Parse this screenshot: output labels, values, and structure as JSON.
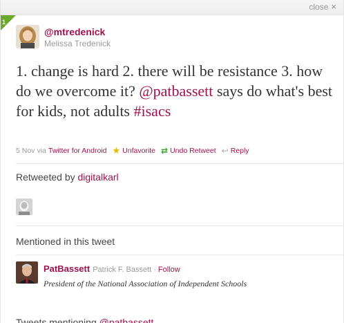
{
  "window": {
    "close_label": "close",
    "close_icon": "×"
  },
  "badge": {
    "count": "1",
    "color": "#6aa92a"
  },
  "tweet": {
    "handle": "@mtredenick",
    "full_name": "Melissa Tredenick",
    "text_part1": "1. change is hard 2. there will be resistance 3. how do we overcome it? ",
    "mention": "@patbassett",
    "text_part2": " says do what's best for kids, not adults ",
    "hashtag": "#isacs",
    "date": "5 Nov",
    "via_label": "via",
    "source": "Twitter for Android",
    "unfavorite_label": "Unfavorite",
    "undo_retweet_label": "Undo Retweet",
    "reply_label": "Reply"
  },
  "retweets": {
    "label": "Retweeted by",
    "user": "digitalkarl"
  },
  "mentions": {
    "title": "Mentioned in this tweet",
    "user": {
      "screen_name": "PatBassett",
      "real_name": "Patrick F. Bassett",
      "separator": "·",
      "follow_label": "Follow",
      "bio": "President of the National Association of Independent Schools"
    }
  },
  "next_section_cut": {
    "prefix": "Tweets mentioning",
    "link": "@patbassett"
  },
  "colors": {
    "link": "#a0114d",
    "muted": "#999999",
    "favorite": "#e6b800",
    "retweet": "#3f9e2f"
  }
}
